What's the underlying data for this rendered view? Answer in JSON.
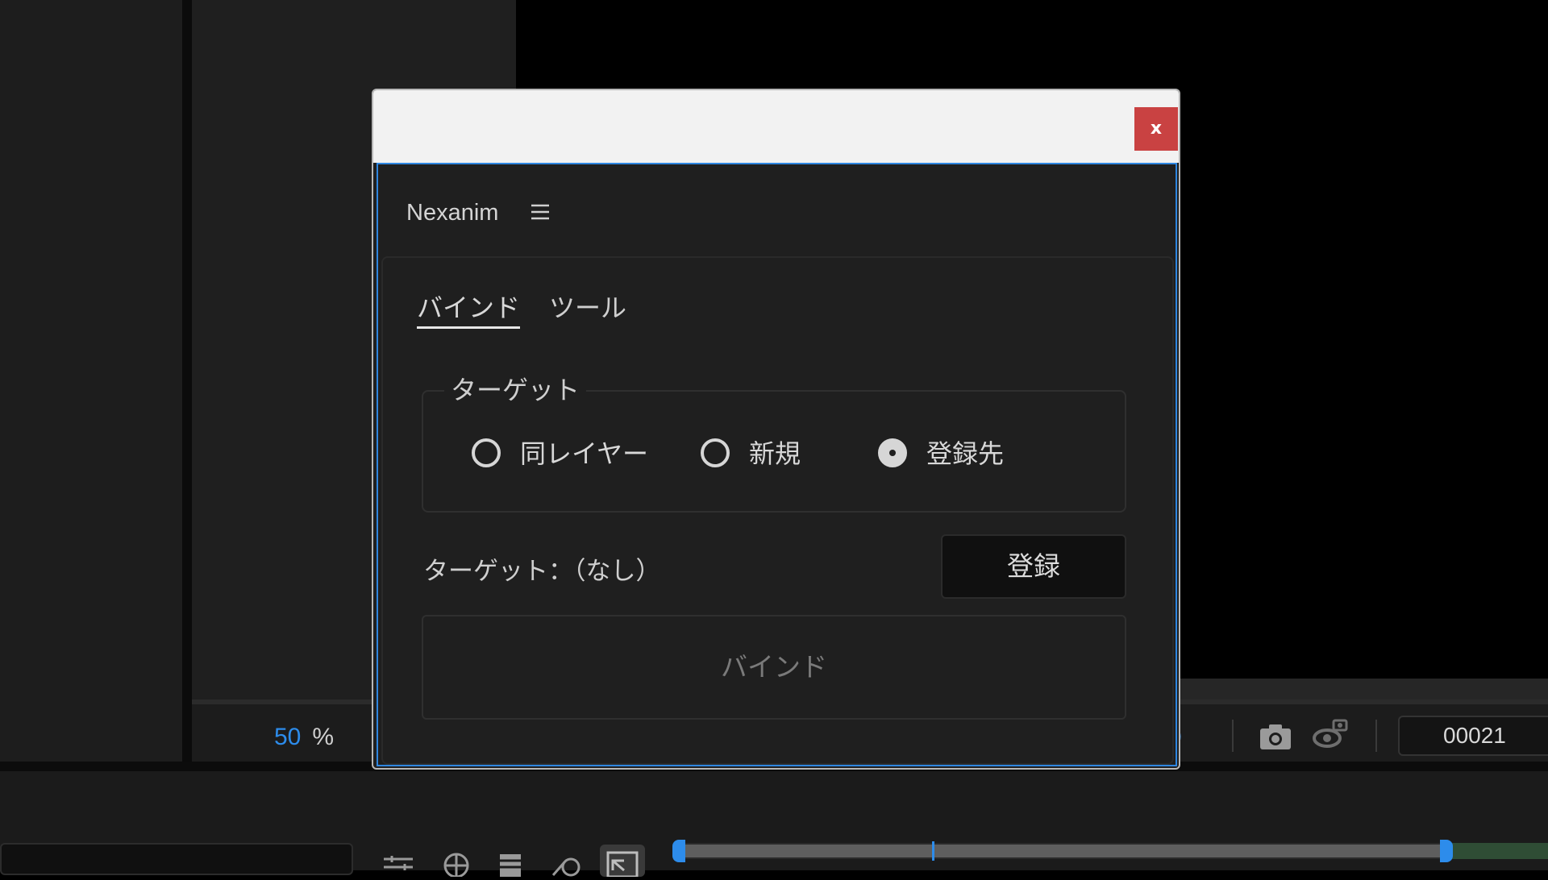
{
  "colors": {
    "accent": "#2d8ceb",
    "dialog_border": "#2e86e0",
    "close_button": "#c94242",
    "panel_bg": "#1f1f1f"
  },
  "viewer": {
    "zoom_value": "50",
    "zoom_unit": "%",
    "frame_number": "00021",
    "snapshot_icon": "camera-icon",
    "show_snapshot_icon": "show-snapshot-icon"
  },
  "dialog": {
    "close_label": "x",
    "panel": {
      "title": "Nexanim",
      "menu_icon": "hamburger-menu-icon",
      "tabs": [
        {
          "label": "バインド",
          "active": true
        },
        {
          "label": "ツール",
          "active": false
        }
      ],
      "target_group": {
        "legend": "ターゲット",
        "options": [
          {
            "label": "同レイヤー",
            "checked": false
          },
          {
            "label": "新規",
            "checked": false
          },
          {
            "label": "登録先",
            "checked": true
          }
        ]
      },
      "target_status": "ターゲット：（なし）",
      "register_label": "登録",
      "bind_label": "バインド"
    }
  },
  "timeline": {
    "tool_icons": [
      "graph-editor-icon",
      "draft-3d-icon",
      "frame-blending-icon",
      "motion-blur-icon",
      "comp-flowchart-icon"
    ]
  }
}
